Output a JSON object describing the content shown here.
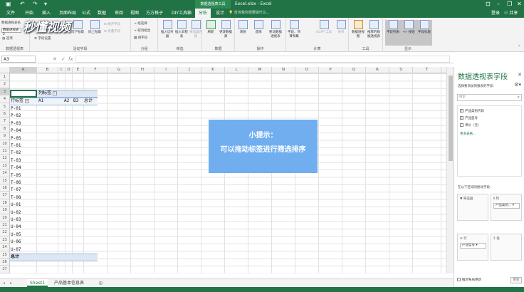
{
  "titlebar": {
    "context_tab": "数据透视表工具",
    "document_title": "Excel.xlsx - Excel",
    "window_controls": [
      "minimize",
      "restore",
      "close"
    ]
  },
  "tabs": {
    "items": [
      "文件",
      "开始",
      "插入",
      "页面布局",
      "公式",
      "数据",
      "审阅",
      "视图",
      "方方格子",
      "DIY工具箱",
      "分析",
      "设计"
    ],
    "active": "分析",
    "tell_me": "告诉我你想要做什么...",
    "login": "登录",
    "share": "共享"
  },
  "ribbon": {
    "pivot_name_label": "数据透视表名",
    "pivot_name_value": "数据透视表2",
    "options": "选项",
    "active_field": "字段设置",
    "drill_down": "向下钻取",
    "drill_up": "向上钻取",
    "expand": "展开字段",
    "collapse": "折叠字段",
    "group_selection": "组选择",
    "ungroup": "取消组合",
    "group_field": "组字段",
    "insert_slicer": "插入切片器",
    "insert_timeline": "插入日程表",
    "filter_connections": "筛选器连接",
    "refresh": "刷新",
    "change_source": "更改数据源",
    "clear": "清除",
    "select": "选择",
    "move_pivot": "移动数据透视表",
    "fields_items_sets": "字段、项目和集",
    "olap_tools": "OLAP 工具",
    "relationships": "关系",
    "pivotchart": "数据透视图",
    "recommended": "推荐的数据透视表",
    "field_list": "字段列表",
    "buttons": "+/- 按钮",
    "field_headers": "字段标题",
    "groups": [
      "数据透视表",
      "活动字段",
      "分组",
      "筛选",
      "数据",
      "操作",
      "计算",
      "工具",
      "显示"
    ]
  },
  "formula_bar": {
    "name_box": "A3",
    "value": ""
  },
  "grid": {
    "columns": [
      "A",
      "B",
      "C",
      "D",
      "E",
      "F",
      "G",
      "H",
      "I",
      "J",
      "K",
      "L",
      "M",
      "N",
      "O",
      "P",
      "Q",
      "R",
      "S",
      "T"
    ],
    "rows": [
      "1",
      "2",
      "3",
      "4",
      "5",
      "6",
      "7",
      "8",
      "9",
      "10",
      "11",
      "12",
      "13",
      "14",
      "15",
      "16",
      "17",
      "18",
      "19",
      "20",
      "21",
      "22",
      "23",
      "24",
      "25",
      "26",
      "27"
    ],
    "pivot": {
      "col_label_header": "列标签",
      "row_label_header": "行标签",
      "col_items": [
        "A1",
        "A2",
        "B3",
        "总计"
      ],
      "row_items": [
        "P-01",
        "P-02",
        "P-03",
        "P-04",
        "P-05",
        "T-01",
        "T-02",
        "T-03",
        "T-04",
        "T-05",
        "T-06",
        "T-07",
        "T-08",
        "U-01",
        "U-02",
        "U-03",
        "U-04",
        "U-05",
        "U-06",
        "U-07"
      ],
      "grand_total": "总计"
    }
  },
  "tip": {
    "line1": "小提示：",
    "line2": "可以拖动标签进行筛选排序"
  },
  "sheets": {
    "tabs": [
      "Sheet1",
      "产品基本信息表"
    ],
    "active": "Sheet1"
  },
  "pane": {
    "title": "数据透视表字段",
    "choose_label": "选择要添加到报表的字段:",
    "search_placeholder": "搜索",
    "fields": [
      {
        "name": "产品类别代码",
        "checked": true
      },
      {
        "name": "产品型号",
        "checked": true
      },
      {
        "name": "单价（元）",
        "checked": false
      }
    ],
    "more_tables": "更多表格...",
    "drag_label": "在以下区域间拖动字段:",
    "area_filter": "筛选器",
    "area_columns": "列",
    "area_rows": "行",
    "area_values": "值",
    "col_field": "产品类别...",
    "row_field": "产品型号",
    "defer_label": "推迟布局更新",
    "update_button": "更新"
  },
  "watermark": "秒懂视频",
  "colors": {
    "excel_green": "#217346",
    "tip_blue": "#70aef0",
    "pivot_header": "#dde7f3"
  }
}
